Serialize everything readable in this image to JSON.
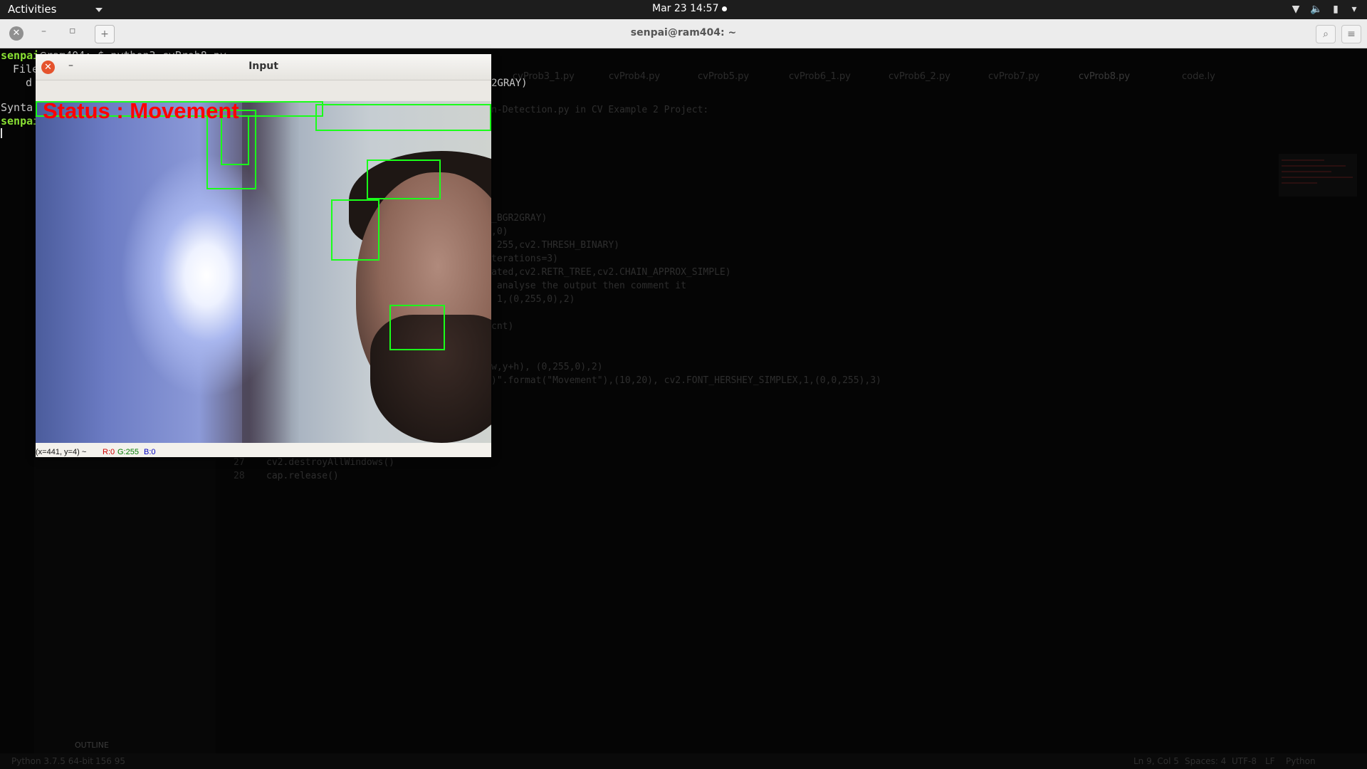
{
  "topbar": {
    "activities": "Activities",
    "clock": "Mar 23  14:57"
  },
  "terminal": {
    "title": "senpai@ram404: ~",
    "lines": {
      "prompt_user": "senpai",
      "prompt_rest": "@ram404:~$ python3 cvProb8.py",
      "file_menu": "File",
      "path_fragment": "d",
      "syntax": "Synta",
      "prompt2": "senpai"
    }
  },
  "vscode": {
    "tabs": [
      "cvProb3_1.py",
      "cvProb4.py",
      "cvProb5.py",
      "cvProb6_1.py",
      "cvProb6_2.py",
      "cvProb7.py",
      "cvProb8.py",
      "code.ly"
    ],
    "active_tab": "cvProb8.py",
    "code_lines": [
      "2GRAY)",
      "n-Detection.py in CV Example 2 Project:",
      "_BGR2GRAY)",
      ",0)",
      " 255,cv2.THRESH_BINARY)",
      "terations=3)",
      "ated,cv2.RETR_TREE,cv2.CHAIN_APPROX_SIMPLE)",
      " analyse the output then comment it",
      " 1,(0,255,0),2)",
      "cnt)",
      "w,y+h), (0,255,0),2)",
      ")\".format(\"Movement\"),(10,20), cv2.FONT_HERSHEY_SIMPLEX,1,(0,0,255),3)"
    ],
    "line_numbers": [
      "27",
      "28"
    ],
    "tail_lines": [
      "cv2.destroyAllWindows()",
      "cap.release()"
    ],
    "outline_label": "OUTLINE",
    "status_left": "Python 3.7.5 64-bit",
    "status_problems": "156  95",
    "status_right": [
      "Ln 9, Col 5",
      "Spaces: 4",
      "UTF-8",
      "LF",
      "Python"
    ]
  },
  "cv_window": {
    "title": "Input",
    "overlay_text": "Status  :  Movement",
    "status_coords": "(x=441, y=4) ~",
    "status_r": "R:0",
    "status_g": "G:255",
    "status_b": "B:0",
    "colors": {
      "box": "#1aff1a",
      "overlay": "#ff0000",
      "close": "#e5532d"
    }
  }
}
